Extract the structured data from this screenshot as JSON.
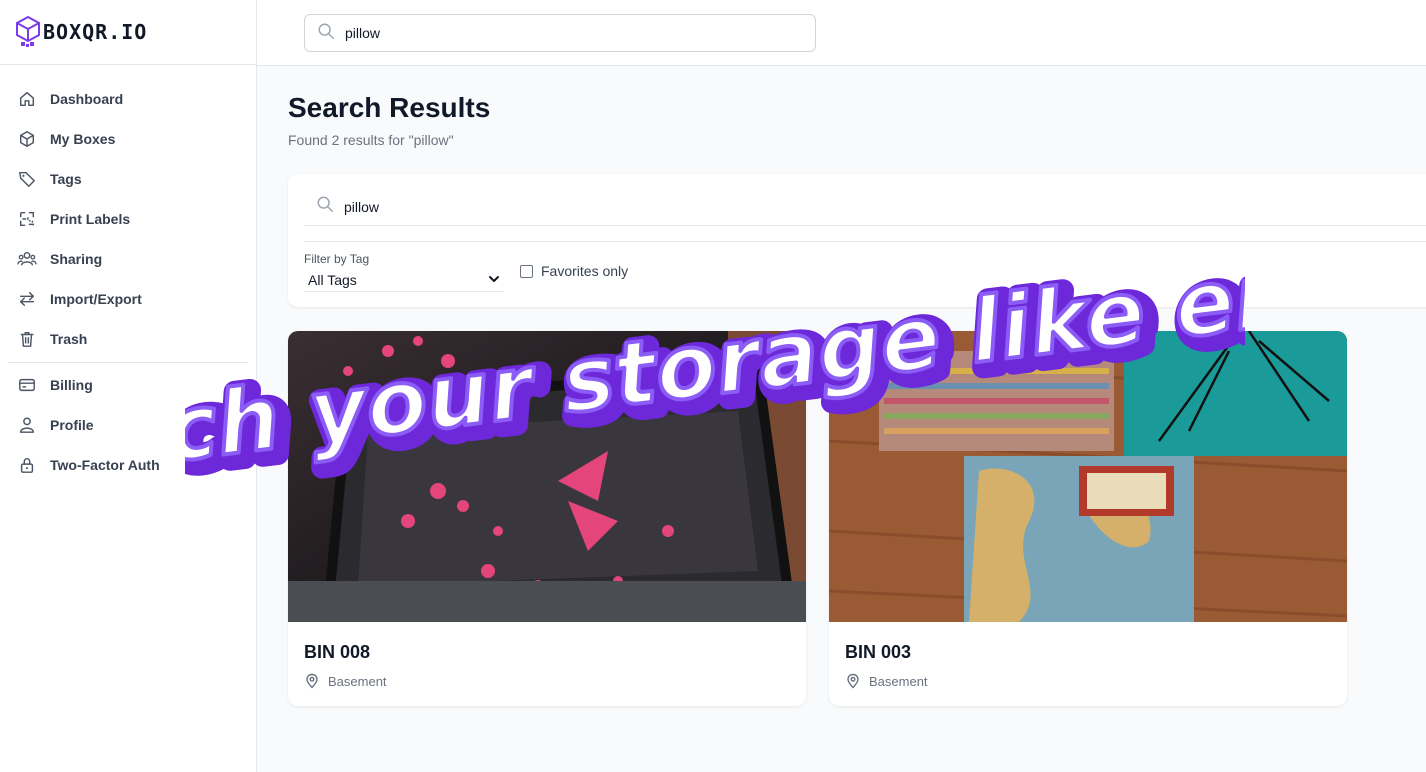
{
  "brand": {
    "name": "BOXQR.IO"
  },
  "sidebar": {
    "items": [
      {
        "label": "Dashboard",
        "icon": "home-icon"
      },
      {
        "label": "My Boxes",
        "icon": "box-icon"
      },
      {
        "label": "Tags",
        "icon": "tag-icon"
      },
      {
        "label": "Print Labels",
        "icon": "qr-icon"
      },
      {
        "label": "Sharing",
        "icon": "users-icon"
      },
      {
        "label": "Import/Export",
        "icon": "arrows-icon"
      },
      {
        "label": "Trash",
        "icon": "trash-icon"
      }
    ],
    "account_items": [
      {
        "label": "Billing",
        "icon": "credit-card-icon"
      },
      {
        "label": "Profile",
        "icon": "user-icon"
      },
      {
        "label": "Two-Factor Auth",
        "icon": "lock-icon"
      }
    ]
  },
  "topbar": {
    "search_value": "pillow"
  },
  "main": {
    "title": "Search Results",
    "subtitle": "Found 2 results for \"pillow\"",
    "search_value": "pillow",
    "filter_label": "Filter by Tag",
    "filter_selected": "All Tags",
    "favorites_label": "Favorites only"
  },
  "results": [
    {
      "title": "BIN 008",
      "location": "Basement"
    },
    {
      "title": "BIN 003",
      "location": "Basement"
    }
  ],
  "banner": {
    "text": "Search your storage like email."
  },
  "colors": {
    "brand_purple": "#7c3aed",
    "banner_outline": "#6d28d9"
  }
}
